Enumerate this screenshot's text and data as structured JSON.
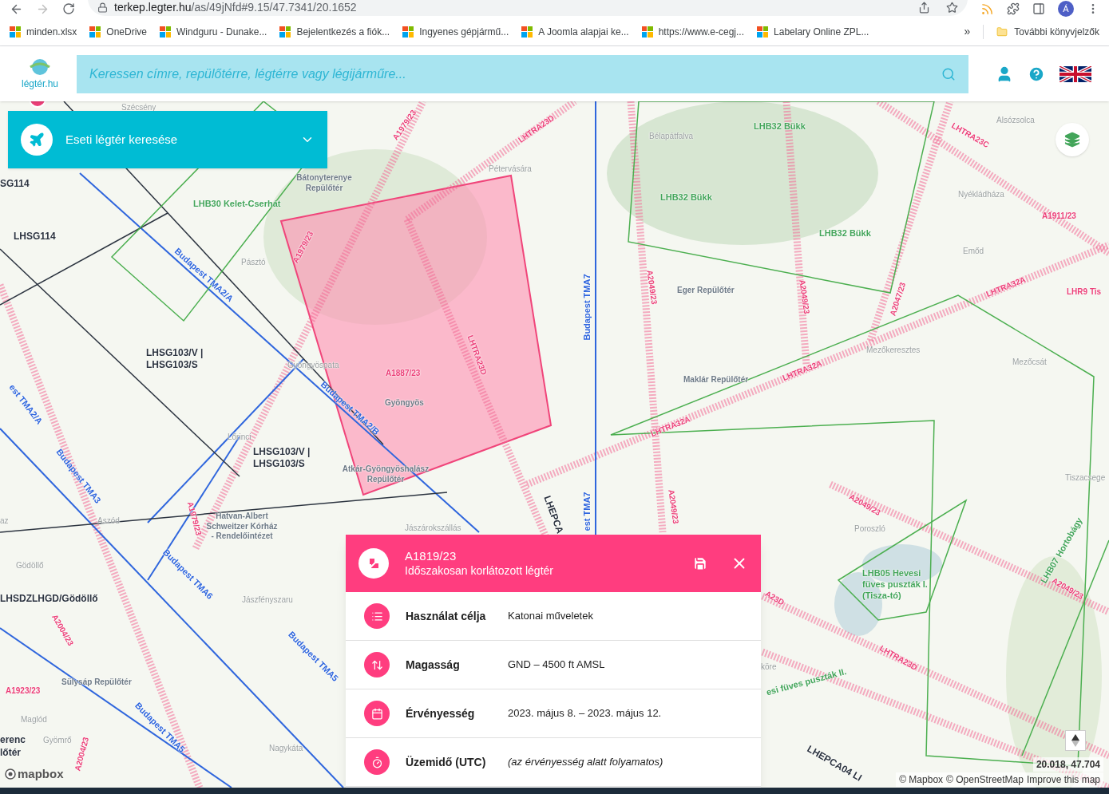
{
  "browser": {
    "url_host": "terkep.legter.hu",
    "url_path": "/as/49jNfd#9.15/47.7341/20.1652",
    "profile_initial": "Á",
    "bookmarks": [
      "minden.xlsx",
      "OneDrive",
      "Windguru - Dunake...",
      "Bejelentkezés a fiók...",
      "Ingyenes gépjármű...",
      "A Joomla alapjai ke...",
      "https://www.e-cegj...",
      "Labelary Online ZPL..."
    ],
    "more_bookmarks": "»",
    "other_bookmarks": "További könyvjelzők"
  },
  "header": {
    "logo": "légtér.hu",
    "search": {
      "placeholder": "Keressen címre, repülőtérre, légtérre vagy légijárműre..."
    }
  },
  "search_panel": {
    "title": "Eseti légtér keresése",
    "expanded": false
  },
  "map_labels": [
    {
      "text": "Szécsény",
      "kind": "place"
    },
    {
      "text": "SG114",
      "kind": "zone"
    },
    {
      "text": "LHSG114",
      "kind": "zone"
    },
    {
      "text": "LHB30 Kelet-Cserhát",
      "kind": "park"
    },
    {
      "text": "Bátonyterenye Repülőtér",
      "kind": "airfield"
    },
    {
      "text": "A1979/23",
      "kind": "restricted"
    },
    {
      "text": "LHTRA23D",
      "kind": "restricted"
    },
    {
      "text": "Pétervására",
      "kind": "place"
    },
    {
      "text": "A1979/23",
      "kind": "restricted"
    },
    {
      "text": "Pásztó",
      "kind": "place"
    },
    {
      "text": "Budapest TMA2/A",
      "kind": "tma"
    },
    {
      "text": "LHSG103/V | LHSG103/S",
      "kind": "zone"
    },
    {
      "text": "Gyöngyöspata",
      "kind": "place"
    },
    {
      "text": "A1887/23",
      "kind": "restricted"
    },
    {
      "text": "Gyöngyös",
      "kind": "airfield"
    },
    {
      "text": "LHTRA23D",
      "kind": "restricted"
    },
    {
      "text": "Budapest TMA2/B",
      "kind": "tma"
    },
    {
      "text": "est TMA2/A",
      "kind": "tma"
    },
    {
      "text": "Lőrinci",
      "kind": "place"
    },
    {
      "text": "LHSG103/V | LHSG103/S",
      "kind": "zone"
    },
    {
      "text": "Atkár-Gyöngyöshalász Repülőtér",
      "kind": "airfield"
    },
    {
      "text": "Budapest TMA3",
      "kind": "tma"
    },
    {
      "text": "A1979/23",
      "kind": "restricted"
    },
    {
      "text": "Hatvan-Albert Schweitzer Kórház - Rendelőintézet",
      "kind": "airfield"
    },
    {
      "text": "az",
      "kind": "place"
    },
    {
      "text": "Aszód",
      "kind": "place"
    },
    {
      "text": "Jászárokszállás",
      "kind": "place"
    },
    {
      "text": "LHEPCA",
      "kind": "zone"
    },
    {
      "text": "Budapest TMA7",
      "kind": "tma"
    },
    {
      "text": "est TMA7",
      "kind": "tma"
    },
    {
      "text": "Gödöllő",
      "kind": "place"
    },
    {
      "text": "LHSDZLHGD/Gödöllő",
      "kind": "zone"
    },
    {
      "text": "A2004/23",
      "kind": "restricted"
    },
    {
      "text": "Budapest TMA6",
      "kind": "tma"
    },
    {
      "text": "Jászfényszaru",
      "kind": "place"
    },
    {
      "text": "Budapest TMA5",
      "kind": "tma"
    },
    {
      "text": "A1923/23",
      "kind": "restricted"
    },
    {
      "text": "Sülysáp Repülőtér",
      "kind": "airfield"
    },
    {
      "text": "Maglód",
      "kind": "place"
    },
    {
      "text": "Gyömrő",
      "kind": "place"
    },
    {
      "text": "erenc",
      "kind": "zone"
    },
    {
      "text": "lőtér",
      "kind": "zone"
    },
    {
      "text": "A2004/23",
      "kind": "restricted"
    },
    {
      "text": "Budapest TMA5",
      "kind": "tma"
    },
    {
      "text": "Nagykáta",
      "kind": "place"
    },
    {
      "text": "Bélapátfalva",
      "kind": "place"
    },
    {
      "text": "LHB32 Bükk",
      "kind": "park"
    },
    {
      "text": "LHB32 Bükk",
      "kind": "park"
    },
    {
      "text": "LHB32 Bükk",
      "kind": "park"
    },
    {
      "text": "LHTRA23C",
      "kind": "restricted"
    },
    {
      "text": "Alsózsolca",
      "kind": "place"
    },
    {
      "text": "Nyékládháza",
      "kind": "place"
    },
    {
      "text": "A1911/23",
      "kind": "restricted"
    },
    {
      "text": "Emőd",
      "kind": "place"
    },
    {
      "text": "LHR9 Tis",
      "kind": "restricted"
    },
    {
      "text": "A2049/23",
      "kind": "restricted"
    },
    {
      "text": "Eger Repülőtér",
      "kind": "airfield"
    },
    {
      "text": "A2049/23",
      "kind": "restricted"
    },
    {
      "text": "A2047/23",
      "kind": "restricted"
    },
    {
      "text": "LHTRA32A",
      "kind": "restricted"
    },
    {
      "text": "Mezőkeresztes",
      "kind": "place"
    },
    {
      "text": "Mezőcsát",
      "kind": "place"
    },
    {
      "text": "LHTRA32A",
      "kind": "restricted"
    },
    {
      "text": "Maklár Repülőtér",
      "kind": "airfield"
    },
    {
      "text": "LHTRA32A",
      "kind": "restricted"
    },
    {
      "text": "A2049/23",
      "kind": "restricted"
    },
    {
      "text": "Tiszacsege",
      "kind": "place"
    },
    {
      "text": "A2049/23",
      "kind": "restricted"
    },
    {
      "text": "Poroszló",
      "kind": "place"
    },
    {
      "text": "LHB05 Hevesi füves puszták I. (Tisza-tó)",
      "kind": "park"
    },
    {
      "text": "LHB07 Hortobágy",
      "kind": "park"
    },
    {
      "text": "A2049/23",
      "kind": "restricted"
    },
    {
      "text": "A23D",
      "kind": "restricted"
    },
    {
      "text": "köre",
      "kind": "place"
    },
    {
      "text": "esi füves puszták II.",
      "kind": "park"
    },
    {
      "text": "LHTRA23D",
      "kind": "restricted"
    },
    {
      "text": "LHEPCA04 LI",
      "kind": "zone"
    }
  ],
  "popup": {
    "title": "A1819/23",
    "subtitle": "Időszakosan korlátozott légtér",
    "rows": [
      {
        "label": "Használat célja",
        "value": "Katonai műveletek",
        "italic": false
      },
      {
        "label": "Magasság",
        "value": "GND – 4500 ft AMSL",
        "italic": false
      },
      {
        "label": "Érvényesség",
        "value": "2023. május 8. – 2023. május 12.",
        "italic": false
      },
      {
        "label": "Üzemidő (UTC)",
        "value": "(az érvényesség alatt folyamatos)",
        "italic": true
      }
    ]
  },
  "map_footer": {
    "mapbox_logo": "mapbox",
    "coordinates": "20.018, 47.704",
    "attribution": [
      "© Mapbox",
      "© OpenStreetMap"
    ],
    "improve_link": "Improve this map"
  }
}
